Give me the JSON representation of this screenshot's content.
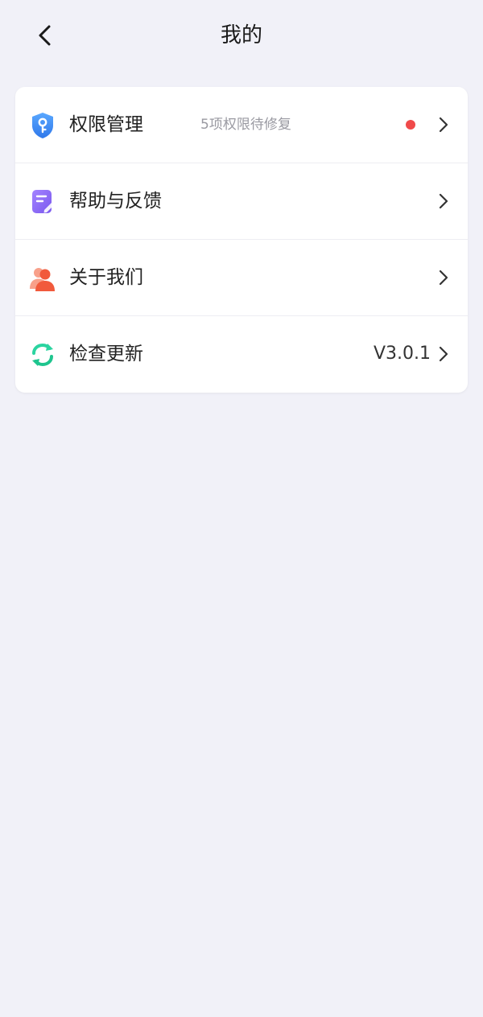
{
  "header": {
    "title": "我的",
    "back_icon": "chevron-left-icon"
  },
  "menu": {
    "items": [
      {
        "id": "permissions",
        "label": "权限管理",
        "sub": "5项权限待修复",
        "icon": "shield-key-icon",
        "has_dot": true
      },
      {
        "id": "help-feedback",
        "label": "帮助与反馈",
        "icon": "edit-note-icon"
      },
      {
        "id": "about",
        "label": "关于我们",
        "icon": "users-icon"
      },
      {
        "id": "check-update",
        "label": "检查更新",
        "value": "V3.0.1",
        "icon": "refresh-icon"
      }
    ]
  },
  "colors": {
    "background": "#f1f1f8",
    "card": "#ffffff",
    "dot": "#f04a4a",
    "shield_blue": "#3d8ef5",
    "note_purple": "#8e6cf0",
    "users_red": "#f46b4f",
    "refresh_green": "#26d49a"
  }
}
